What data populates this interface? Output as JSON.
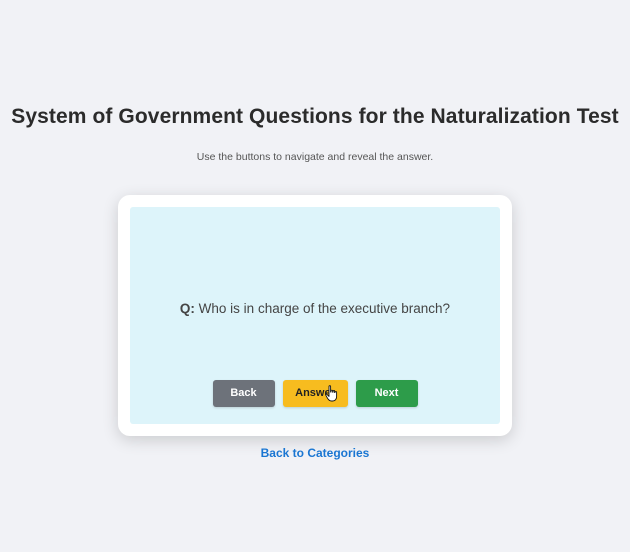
{
  "page": {
    "title": "System of Government Questions for the Naturalization Test",
    "subtitle": "Use the buttons to navigate and reveal the answer."
  },
  "card": {
    "question_prefix": "Q:",
    "question_text": " Who is in charge of the executive branch?"
  },
  "buttons": {
    "back_label": "Back",
    "answer_label": "Answer",
    "next_label": "Next"
  },
  "links": {
    "back_to_categories": "Back to Categories"
  },
  "colors": {
    "back_button": "#6d727a",
    "answer_button": "#f7bc1f",
    "next_button": "#2d9c4a",
    "card_background": "#ddf4fa",
    "link": "#1a76d2"
  },
  "icons": {
    "cursor": "hand-pointer-icon"
  }
}
